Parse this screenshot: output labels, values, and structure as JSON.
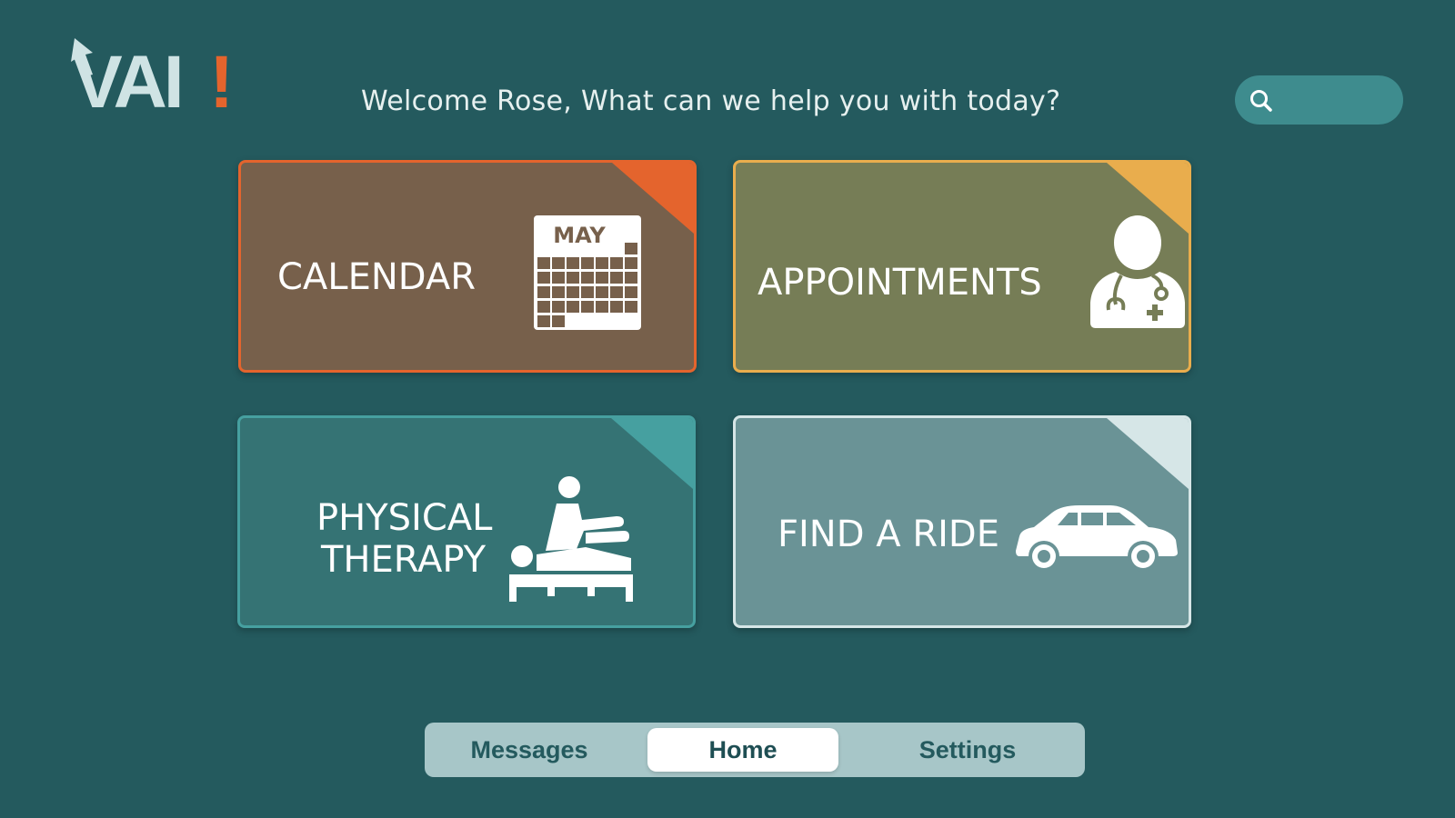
{
  "app": {
    "logo_text": "VAI!",
    "logo_icon": "arrow-up-left-icon"
  },
  "header": {
    "welcome": "Welcome Rose, What can we help you with today?",
    "search": {
      "placeholder": "",
      "value": "",
      "icon": "search-icon"
    }
  },
  "cards": {
    "calendar": {
      "label": "CALENDAR",
      "icon": "calendar-icon",
      "month": "MAY",
      "accent": "#e4642d",
      "bg": "#77604b"
    },
    "appointments": {
      "label": "APPOINTMENTS",
      "icon": "doctor-icon",
      "accent": "#e9ad4d",
      "bg": "#767d56"
    },
    "therapy": {
      "label_line1": "PHYSICAL",
      "label_line2": "THERAPY",
      "icon": "physical-therapy-icon",
      "accent": "#46a0a0",
      "bg": "#357374"
    },
    "ride": {
      "label": "FIND A RIDE",
      "icon": "car-icon",
      "accent": "#d6e6e7",
      "bg": "#6a9396"
    }
  },
  "nav": {
    "tabs": [
      {
        "label": "Messages",
        "active": false
      },
      {
        "label": "Home",
        "active": true
      },
      {
        "label": "Settings",
        "active": false
      }
    ]
  },
  "colors": {
    "background": "#245a5e",
    "logo": "#cfe3e4",
    "logo_exclaim": "#e4642d"
  }
}
